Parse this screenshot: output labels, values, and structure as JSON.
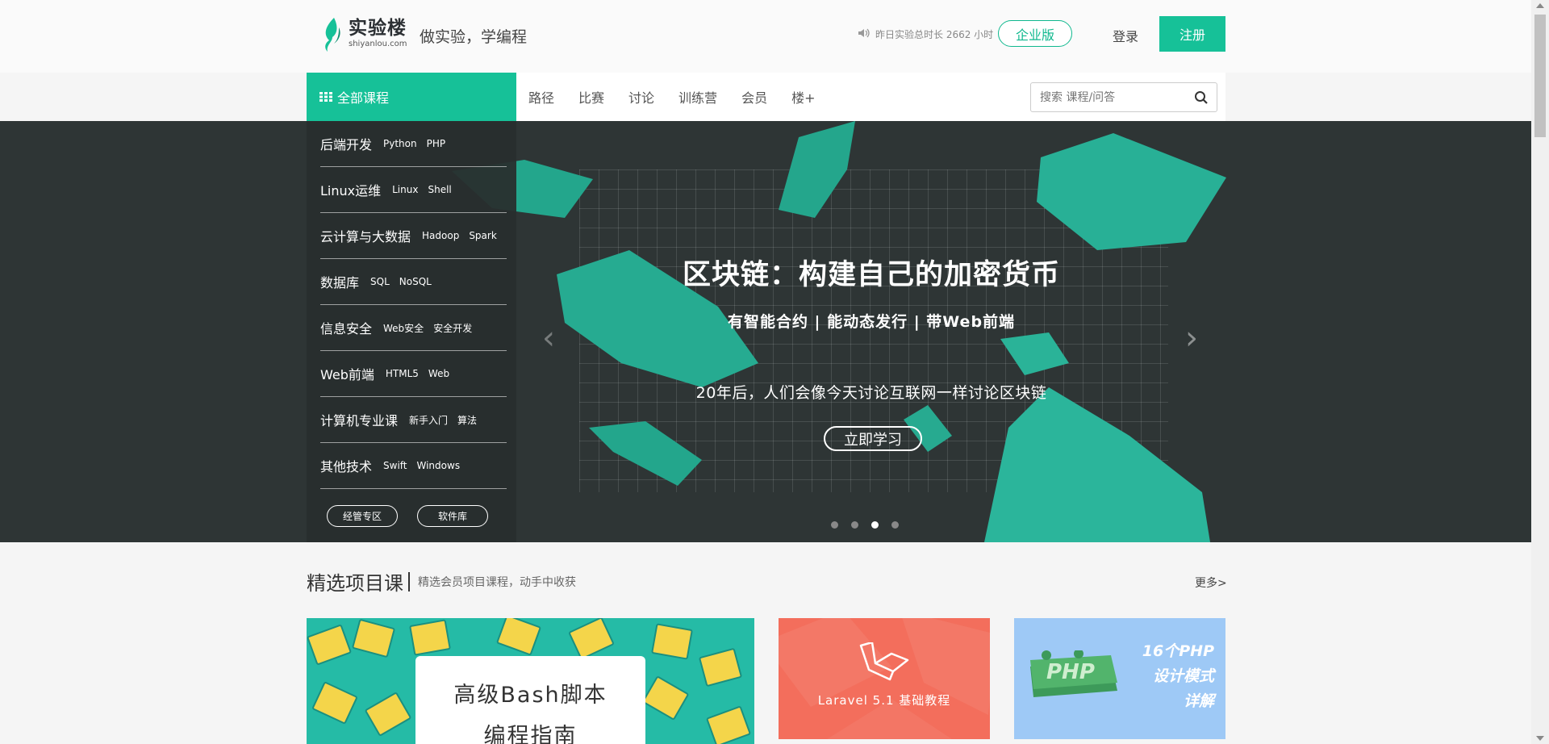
{
  "header": {
    "logo_name": "实验楼",
    "logo_domain": "shiyanlou.com",
    "slogan": "做实验，学编程",
    "stat_text": "昨日实验总时长 2662 小时",
    "enterprise_label": "企业版",
    "login_label": "登录",
    "register_label": "注册"
  },
  "nav": {
    "all_courses": "全部课程",
    "links": [
      "路径",
      "比赛",
      "讨论",
      "训练营",
      "会员",
      "楼+"
    ],
    "search_placeholder": "搜索 课程/问答"
  },
  "categories": [
    {
      "name": "后端开发",
      "tags": [
        "Python",
        "PHP"
      ]
    },
    {
      "name": "Linux运维",
      "tags": [
        "Linux",
        "Shell"
      ]
    },
    {
      "name": "云计算与大数据",
      "tags": [
        "Hadoop",
        "Spark"
      ]
    },
    {
      "name": "数据库",
      "tags": [
        "SQL",
        "NoSQL"
      ]
    },
    {
      "name": "信息安全",
      "tags": [
        "Web安全",
        "安全开发"
      ]
    },
    {
      "name": "Web前端",
      "tags": [
        "HTML5",
        "Web"
      ]
    },
    {
      "name": "计算机专业课",
      "tags": [
        "新手入门",
        "算法"
      ]
    },
    {
      "name": "其他技术",
      "tags": [
        "Swift",
        "Windows"
      ]
    }
  ],
  "category_buttons": [
    "经管专区",
    "软件库"
  ],
  "hero": {
    "title": "区块链：构建自己的加密货币",
    "subtitle": "有智能合约 | 能动态发行 | 带Web前端",
    "description": "20年后，人们会像今天讨论互联网一样讨论区块链",
    "cta": "立即学习",
    "active_slide": 3,
    "slide_count": 4
  },
  "featured": {
    "title": "精选项目课",
    "subtitle": "精选会员项目课程，动手中收获",
    "more": "更多>",
    "cards": [
      {
        "line1": "高级Bash脚本",
        "line2": "编程指南"
      },
      {
        "text": "Laravel 5.1 基础教程"
      },
      {
        "line1": "16个PHP",
        "line2": "设计模式",
        "line3": "详解",
        "badge": "PHP"
      }
    ]
  },
  "colors": {
    "brand": "#16c198",
    "hero_bg": "#2e3535",
    "laravel": "#f36e5c",
    "php": "#9ec9f6"
  }
}
